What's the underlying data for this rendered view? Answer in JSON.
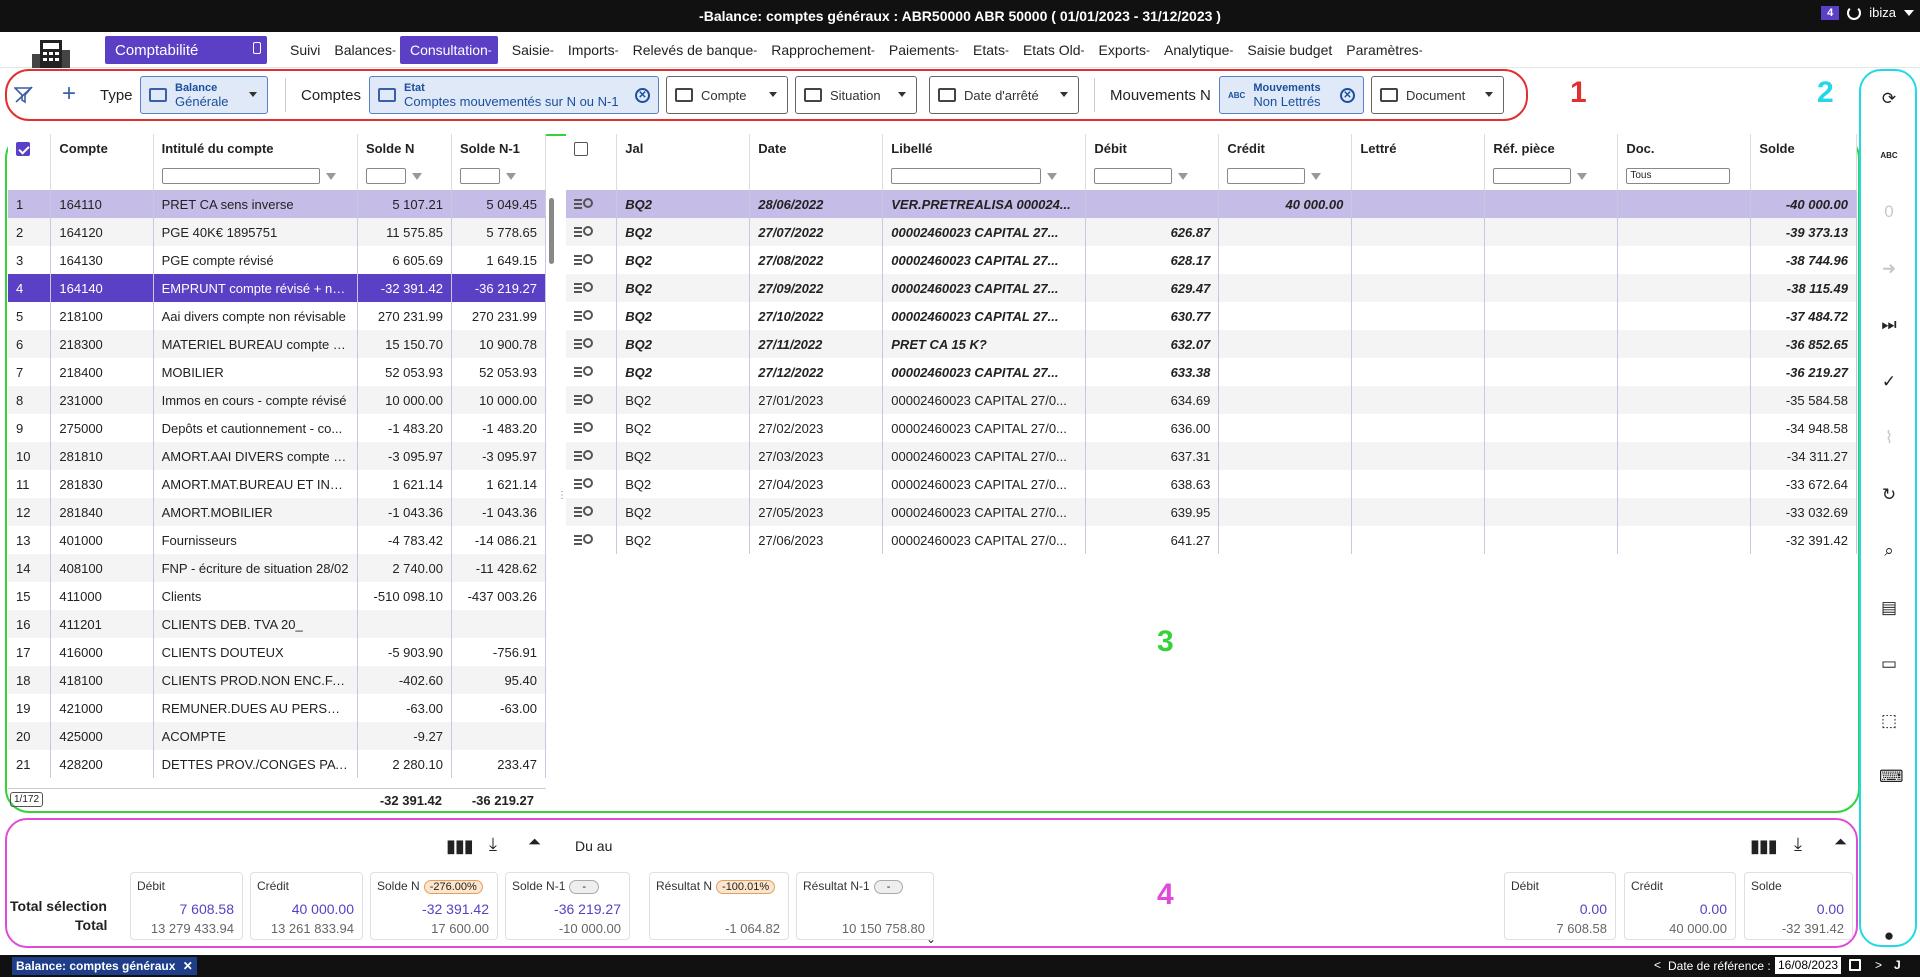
{
  "titlebar": {
    "title": "-Balance: comptes généraux : ABR50000 ABR 50000 ( 01/01/2023 - 31/12/2023 )",
    "notif_count": "4",
    "user": "ibiza"
  },
  "app": {
    "name": "Comptabilité"
  },
  "menu": [
    "Suivi",
    "Balances",
    "Consultation",
    "Saisie",
    "Imports",
    "Relevés de banque",
    "Rapprochement",
    "Paiements",
    "Etats",
    "Etats Old",
    "Exports",
    "Analytique",
    "Saisie budget",
    "Paramètres"
  ],
  "menu_arrows": [
    "",
    "-",
    "-",
    "-",
    "-",
    "-",
    "-",
    "-",
    "-",
    "-",
    "-",
    "-",
    "",
    "-"
  ],
  "filters": {
    "type_label": "Type",
    "type_chip_top": "Balance",
    "type_chip_bottom": "Générale",
    "comptes_label": "Comptes",
    "etat_top": "Etat",
    "etat_bottom": "Comptes mouvementés sur N ou N-1",
    "compte": "Compte",
    "situation": "Situation",
    "date_arrete": "Date d'arrêté",
    "mouv_label": "Mouvements N",
    "mouv_top": "Mouvements",
    "mouv_bottom": "Non Lettrés",
    "document": "Document"
  },
  "annotations": {
    "a1": "1",
    "a2": "2",
    "a3": "3",
    "a4": "4"
  },
  "left_table": {
    "headers": [
      "Compte",
      "Intitulé du compte",
      "Solde N",
      "Solde N-1"
    ],
    "rows": [
      [
        "1",
        "164110",
        "PRET CA sens inverse",
        "5 107.21",
        "5 049.45"
      ],
      [
        "2",
        "164120",
        "PGE 40K€ 1895751",
        "11 575.85",
        "5 778.65"
      ],
      [
        "3",
        "164130",
        "PGE compte révisé",
        "6 605.69",
        "1 649.15"
      ],
      [
        "4",
        "164140",
        "EMPRUNT compte révisé + not...",
        "-32 391.42",
        "-36 219.27"
      ],
      [
        "5",
        "218100",
        "Aai divers compte non révisable",
        "270 231.99",
        "270 231.99"
      ],
      [
        "6",
        "218300",
        "MATERIEL BUREAU compte à r...",
        "15 150.70",
        "10 900.78"
      ],
      [
        "7",
        "218400",
        "MOBILIER",
        "52 053.93",
        "52 053.93"
      ],
      [
        "8",
        "231000",
        "Immos en cours - compte révisé",
        "10 000.00",
        "10 000.00"
      ],
      [
        "9",
        "275000",
        "Depôts et cautionnement - co...",
        "-1 483.20",
        "-1 483.20"
      ],
      [
        "10",
        "281810",
        "AMORT.AAI DIVERS compte ré...",
        "-3 095.97",
        "-3 095.97"
      ],
      [
        "11",
        "281830",
        "AMORT.MAT.BUREAU ET INFO.",
        "1 621.14",
        "1 621.14"
      ],
      [
        "12",
        "281840",
        "AMORT.MOBILIER",
        "-1 043.36",
        "-1 043.36"
      ],
      [
        "13",
        "401000",
        "Fournisseurs",
        "-4 783.42",
        "-14 086.21"
      ],
      [
        "14",
        "408100",
        "FNP - écriture de situation 28/02",
        "2 740.00",
        "-11 428.62"
      ],
      [
        "15",
        "411000",
        "Clients",
        "-510 098.10",
        "-437 003.26"
      ],
      [
        "16",
        "411201",
        "CLIENTS DEB. TVA 20_",
        "",
        ""
      ],
      [
        "17",
        "416000",
        "CLIENTS DOUTEUX",
        "-5 903.90",
        "-756.91"
      ],
      [
        "18",
        "418100",
        "CLIENTS PROD.NON ENC.FACT",
        "-402.60",
        "95.40"
      ],
      [
        "19",
        "421000",
        "REMUNER.DUES AU PERSONN...",
        "-63.00",
        "-63.00"
      ],
      [
        "20",
        "425000",
        "ACOMPTE",
        "-9.27",
        ""
      ],
      [
        "21",
        "428200",
        "DETTES PROV./CONGES PAYES",
        "2 280.10",
        "233.47"
      ]
    ],
    "footer_count": "1/172",
    "footer_solde_n": "-32 391.42",
    "footer_solde_n1": "-36 219.27"
  },
  "right_table": {
    "headers": [
      "Jal",
      "Date",
      "Libellé",
      "Débit",
      "Crédit",
      "Lettré",
      "Réf. pièce",
      "Doc.",
      "Solde"
    ],
    "doc_filter": "Tous",
    "rows": [
      [
        "BQ2",
        "28/06/2022",
        "VER.PRETREALISA 000024...",
        "",
        "40 000.00",
        "",
        "",
        "",
        "-40 000.00"
      ],
      [
        "BQ2",
        "27/07/2022",
        "00002460023 CAPITAL 27...",
        "626.87",
        "",
        "",
        "",
        "",
        "-39 373.13"
      ],
      [
        "BQ2",
        "27/08/2022",
        "00002460023 CAPITAL 27...",
        "628.17",
        "",
        "",
        "",
        "",
        "-38 744.96"
      ],
      [
        "BQ2",
        "27/09/2022",
        "00002460023 CAPITAL 27...",
        "629.47",
        "",
        "",
        "",
        "",
        "-38 115.49"
      ],
      [
        "BQ2",
        "27/10/2022",
        "00002460023 CAPITAL 27...",
        "630.77",
        "",
        "",
        "",
        "",
        "-37 484.72"
      ],
      [
        "BQ2",
        "27/11/2022",
        "PRET CA 15 K?",
        "632.07",
        "",
        "",
        "",
        "",
        "-36 852.65"
      ],
      [
        "BQ2",
        "27/12/2022",
        "00002460023 CAPITAL 27...",
        "633.38",
        "",
        "",
        "",
        "",
        "-36 219.27"
      ],
      [
        "BQ2",
        "27/01/2023",
        "00002460023 CAPITAL 27/0...",
        "634.69",
        "",
        "",
        "",
        "",
        "-35 584.58"
      ],
      [
        "BQ2",
        "27/02/2023",
        "00002460023 CAPITAL 27/0...",
        "636.00",
        "",
        "",
        "",
        "",
        "-34 948.58"
      ],
      [
        "BQ2",
        "27/03/2023",
        "00002460023 CAPITAL 27/0...",
        "637.31",
        "",
        "",
        "",
        "",
        "-34 311.27"
      ],
      [
        "BQ2",
        "27/04/2023",
        "00002460023 CAPITAL 27/0...",
        "638.63",
        "",
        "",
        "",
        "",
        "-33 672.64"
      ],
      [
        "BQ2",
        "27/05/2023",
        "00002460023 CAPITAL 27/0...",
        "639.95",
        "",
        "",
        "",
        "",
        "-33 032.69"
      ],
      [
        "BQ2",
        "27/06/2023",
        "00002460023 CAPITAL 27/0...",
        "641.27",
        "",
        "",
        "",
        "",
        "-32 391.42"
      ]
    ],
    "bold_rows": 7
  },
  "totals": {
    "label_sel": "Total sélection",
    "label_total": "Total",
    "du_au": "Du au",
    "debit": {
      "h": "Débit",
      "v1": "7 608.58",
      "v2": "13 279 433.94"
    },
    "credit": {
      "h": "Crédit",
      "v1": "40 000.00",
      "v2": "13 261 833.94"
    },
    "solde_n": {
      "h": "Solde N",
      "pill": "-276.00%",
      "v1": "-32 391.42",
      "v2": "17 600.00"
    },
    "solde_n1": {
      "h": "Solde N-1",
      "pill": "-",
      "v1": "-36 219.27",
      "v2": "-10 000.00"
    },
    "resultat_n": {
      "h": "Résultat N",
      "pill": "-100.01%",
      "v1": "",
      "v2": "-1 064.82"
    },
    "resultat_n1": {
      "h": "Résultat N-1",
      "pill": "-",
      "v1": "",
      "v2": "10 150 758.80"
    },
    "r_debit": {
      "h": "Débit",
      "v1": "0.00",
      "v2": "7 608.58"
    },
    "r_credit": {
      "h": "Crédit",
      "v1": "0.00",
      "v2": "40 000.00"
    },
    "r_solde": {
      "h": "Solde",
      "v1": "0.00",
      "v2": "-32 391.42"
    }
  },
  "statusbar": {
    "tab": "Balance: comptes généraux",
    "ref_label": "Date de référence :",
    "ref_date": "16/08/2023",
    "nav_prev": "<",
    "nav_next": ">",
    "nav_j": "J"
  },
  "rail_icons": [
    "sync-icon",
    "abc-icon",
    "zero-icon",
    "arrow-right-icon",
    "skip-end-icon",
    "check-add-icon",
    "paperclip-icon",
    "refresh-icon",
    "search-icon",
    "document-icon",
    "window-icon",
    "select-icon",
    "keyboard-icon",
    "lightbulb-icon"
  ]
}
